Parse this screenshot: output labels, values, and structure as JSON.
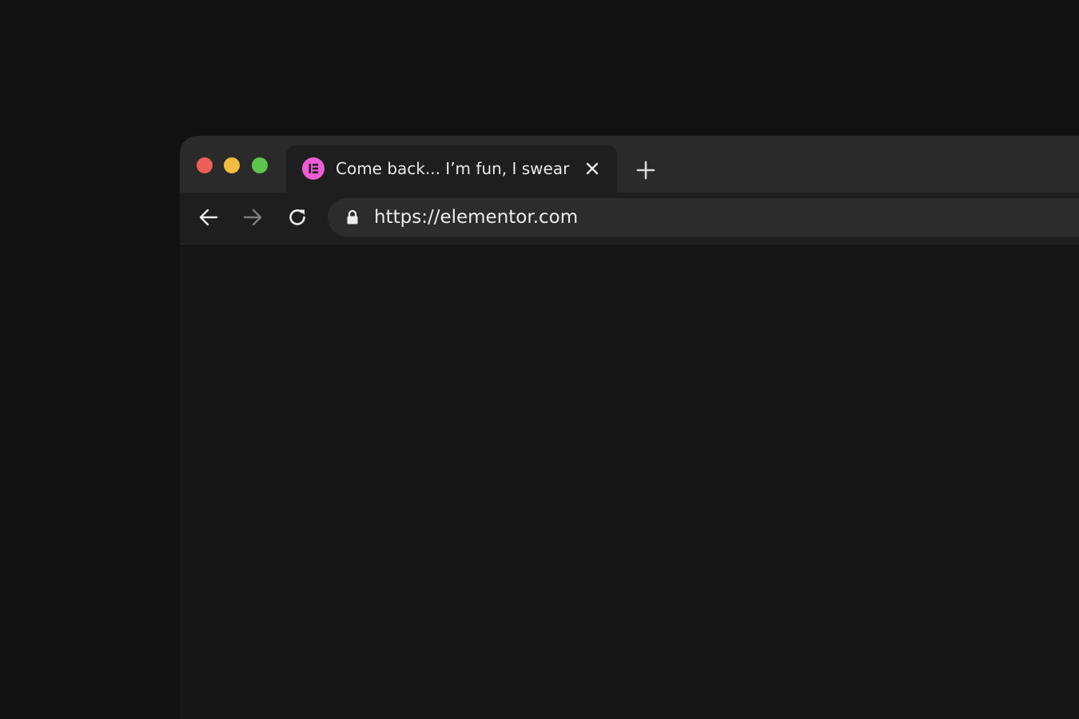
{
  "window": {
    "traffic_lights": {
      "close_color": "#ec5f57",
      "minimize_color": "#f4bd41",
      "maximize_color": "#5fc44c"
    }
  },
  "tab": {
    "title": "Come back... I’m fun, I swear",
    "favicon": "elementor-logo-icon",
    "favicon_color": "#ef5cd6",
    "close_icon": "close-icon"
  },
  "new_tab_icon": "plus-icon",
  "toolbar": {
    "back_icon": "arrow-left-icon",
    "forward_icon": "arrow-right-icon",
    "reload_icon": "reload-icon",
    "lock_icon": "lock-icon",
    "url": "https://elementor.com"
  }
}
